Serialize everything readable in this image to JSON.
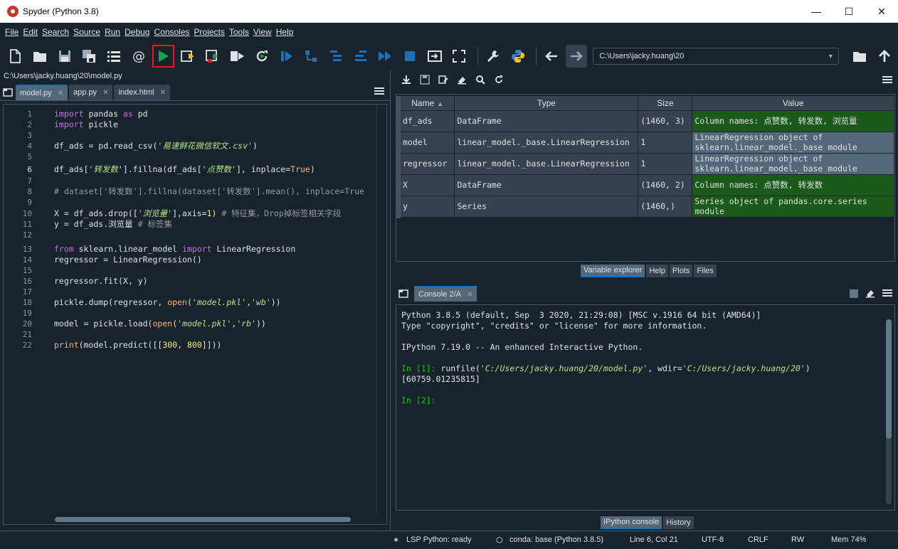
{
  "window": {
    "title": "Spyder (Python 3.8)"
  },
  "menu": [
    "File",
    "Edit",
    "Search",
    "Source",
    "Run",
    "Debug",
    "Consoles",
    "Projects",
    "Tools",
    "View",
    "Help"
  ],
  "toolbar": {
    "path": "C:\\Users\\jacky.huang\\20"
  },
  "editor": {
    "filepath": "C:\\Users\\jacky.huang\\20\\model.py",
    "tabs": [
      {
        "label": "model.py",
        "close": "✕"
      },
      {
        "label": "app.py",
        "close": "✕"
      },
      {
        "label": "index.html",
        "close": "✕"
      }
    ],
    "line_numbers": [
      "1",
      "2",
      "3",
      "4",
      "5",
      "6",
      "7",
      "8",
      "9",
      "10",
      "11",
      "12",
      "13",
      "14",
      "15",
      "16",
      "17",
      "18",
      "19",
      "20",
      "21",
      "22"
    ],
    "current_line": "6"
  },
  "varexplorer": {
    "headers": [
      "Name",
      "Type",
      "Size",
      "Value"
    ],
    "rows": [
      {
        "name": "df_ads",
        "type": "DataFrame",
        "size": "(1460, 3)",
        "value": "Column names: 点赞数, 转发数, 浏览量"
      },
      {
        "name": "model",
        "type": "linear_model._base.LinearRegression",
        "size": "1",
        "value": "LinearRegression object of sklearn.linear_model._base module"
      },
      {
        "name": "regressor",
        "type": "linear_model._base.LinearRegression",
        "size": "1",
        "value": "LinearRegression object of sklearn.linear_model._base module"
      },
      {
        "name": "X",
        "type": "DataFrame",
        "size": "(1460, 2)",
        "value": "Column names: 点赞数, 转发数"
      },
      {
        "name": "y",
        "type": "Series",
        "size": "(1460,)",
        "value": "Series object of pandas.core.series module"
      }
    ],
    "tabs": [
      "Variable explorer",
      "Help",
      "Plots",
      "Files"
    ]
  },
  "console": {
    "tab": "Console 2/A",
    "close": "✕",
    "lines": [
      "Python 3.8.5 (default, Sep  3 2020, 21:29:08) [MSC v.1916 64 bit (AMD64)]",
      "Type \"copyright\", \"credits\" or \"license\" for more information.",
      "IPython 7.19.0 -- An enhanced Interactive Python.",
      "[60759.01235815]"
    ],
    "in1_prompt": "In [1]: ",
    "in1_code_pre": "runfile(",
    "in1_arg1": "'C:/Users/jacky.huang/20/model.py'",
    "in1_mid": ", wdir=",
    "in1_arg2": "'C:/Users/jacky.huang/20'",
    "in1_end": ")",
    "in2_prompt": "In [2]:",
    "tabs": [
      "IPython console",
      "History"
    ]
  },
  "status": {
    "lsp": "LSP Python: ready",
    "conda": "conda: base (Python 3.8.5)",
    "position": "Line 6, Col 21",
    "encoding": "UTF-8",
    "eol": "CRLF",
    "rw": "RW",
    "mem": "Mem 74%"
  },
  "colors": {
    "background": "#19232d",
    "accent": "#1a72bb",
    "green_cell": "#1c5a1c",
    "prompt": "#00cc00"
  }
}
